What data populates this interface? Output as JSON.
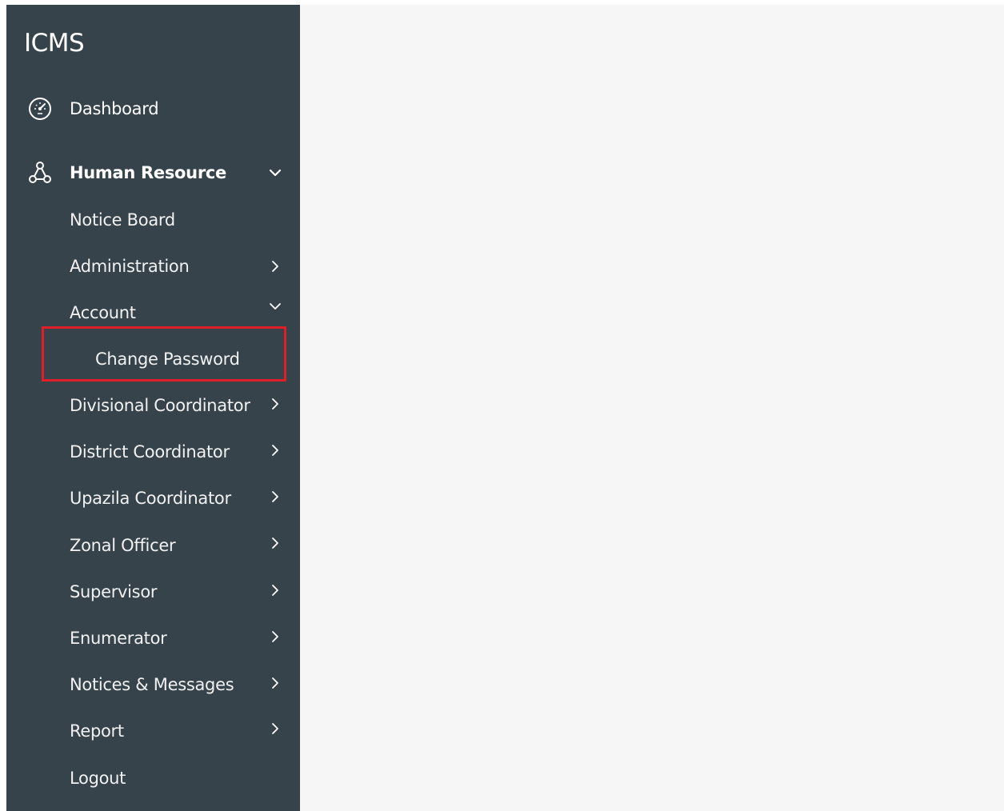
{
  "app": {
    "title": "ICMS"
  },
  "colors": {
    "sidebar_bg": "#36434b",
    "content_bg": "#f6f6f6",
    "highlight": "#e01e27"
  },
  "sidebar": {
    "dashboard": {
      "label": "Dashboard",
      "icon": "dashboard-gauge-icon"
    },
    "human_resource": {
      "label": "Human Resource",
      "icon": "network-icon",
      "expanded": true,
      "children": {
        "notice_board": {
          "label": "Notice Board"
        },
        "administration": {
          "label": "Administration"
        },
        "account": {
          "label": "Account",
          "expanded": true,
          "children": {
            "change_password": {
              "label": "Change Password"
            }
          }
        },
        "divisional_coordinator": {
          "label": "Divisional Coordinator"
        },
        "district_coordinator": {
          "label": "District Coordinator"
        },
        "upazila_coordinator": {
          "label": "Upazila Coordinator"
        },
        "zonal_officer": {
          "label": "Zonal Officer"
        },
        "supervisor": {
          "label": "Supervisor"
        },
        "enumerator": {
          "label": "Enumerator"
        },
        "notices_messages": {
          "label": "Notices & Messages"
        },
        "report": {
          "label": "Report"
        },
        "logout": {
          "label": "Logout"
        }
      }
    }
  }
}
